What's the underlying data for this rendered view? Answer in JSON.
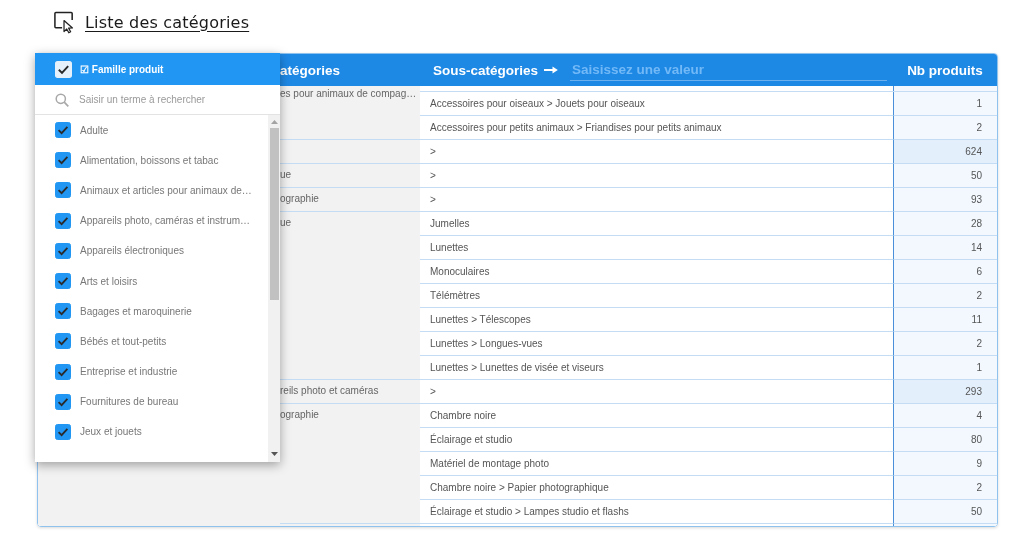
{
  "page": {
    "title": "Liste des catégories"
  },
  "table": {
    "columns": [
      {
        "label": "atégories"
      },
      {
        "label": "Sous-catégories",
        "filter_placeholder": "Saisissez une valeur"
      },
      {
        "label": "Nb produits"
      }
    ],
    "groups": [
      {
        "category": "es pour animaux de compag…",
        "rows": [
          {
            "subcategory": "Accessoires pour oiseaux > Jouets pour oiseaux",
            "count": "1",
            "highlighted": false
          },
          {
            "subcategory": "Accessoires pour petits animaux > Friandises pour petits animaux",
            "count": "2",
            "highlighted": false
          }
        ]
      },
      {
        "rows": [
          {
            "subcategory": ">",
            "count": "624",
            "highlighted": true
          }
        ]
      },
      {
        "category": "ue",
        "rows": [
          {
            "subcategory": ">",
            "count": "50",
            "highlighted": false
          }
        ]
      },
      {
        "category": "ographie",
        "rows": [
          {
            "subcategory": ">",
            "count": "93",
            "highlighted": false
          }
        ]
      },
      {
        "category": "ue",
        "rows": [
          {
            "subcategory": "Jumelles",
            "count": "28",
            "highlighted": false
          },
          {
            "subcategory": "Lunettes",
            "count": "14",
            "highlighted": false
          },
          {
            "subcategory": "Monoculaires",
            "count": "6",
            "highlighted": false
          },
          {
            "subcategory": "Télémètres",
            "count": "2",
            "highlighted": false
          },
          {
            "subcategory": "Lunettes > Télescopes",
            "count": "11",
            "highlighted": false
          },
          {
            "subcategory": "Lunettes > Longues-vues",
            "count": "2",
            "highlighted": false
          },
          {
            "subcategory": "Lunettes > Lunettes de visée et viseurs",
            "count": "1",
            "highlighted": false
          }
        ]
      },
      {
        "category": "reils photo et caméras",
        "rows": [
          {
            "subcategory": ">",
            "count": "293",
            "highlighted": true
          }
        ]
      },
      {
        "category": "ographie",
        "rows": [
          {
            "subcategory": "Chambre noire",
            "count": "4",
            "highlighted": false
          },
          {
            "subcategory": "Éclairage et studio",
            "count": "80",
            "highlighted": false
          },
          {
            "subcategory": "Matériel de montage photo",
            "count": "9",
            "highlighted": false
          },
          {
            "subcategory": "Chambre noire > Papier photographique",
            "count": "2",
            "highlighted": false
          },
          {
            "subcategory": "Éclairage et studio > Lampes studio et flashs",
            "count": "50",
            "highlighted": false
          }
        ]
      }
    ]
  },
  "filter_dropdown": {
    "label": "☑ Famille produit",
    "checked": true,
    "search_placeholder": "Saisir un terme à rechercher",
    "options": [
      {
        "label": "Adulte",
        "checked": true
      },
      {
        "label": "Alimentation, boissons et tabac",
        "checked": true
      },
      {
        "label": "Animaux et articles pour animaux de…",
        "checked": true
      },
      {
        "label": "Appareils photo, caméras et instrum…",
        "checked": true
      },
      {
        "label": "Appareils électroniques",
        "checked": true
      },
      {
        "label": "Arts et loisirs",
        "checked": true
      },
      {
        "label": "Bagages et maroquinerie",
        "checked": true
      },
      {
        "label": "Bébés et tout-petits",
        "checked": true
      },
      {
        "label": "Entreprise et industrie",
        "checked": true
      },
      {
        "label": "Fournitures de bureau",
        "checked": true
      },
      {
        "label": "Jeux et jouets",
        "checked": true
      }
    ]
  }
}
